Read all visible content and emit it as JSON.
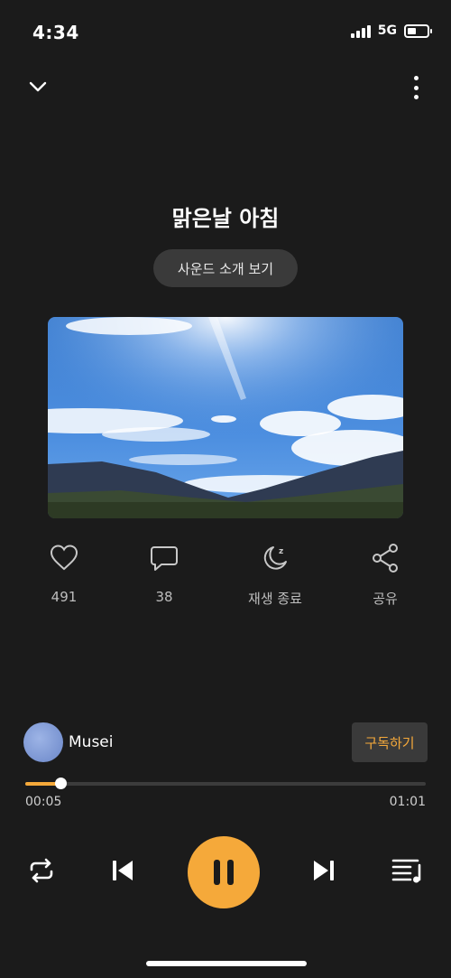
{
  "status_bar": {
    "time": "4:34",
    "network": "5G",
    "battery_level": 0.45
  },
  "header": {
    "collapse_icon": "chevron-down-icon",
    "menu_icon": "more-vertical-icon"
  },
  "track": {
    "title": "맑은날 아침",
    "intro_button_label": "사운드 소개 보기"
  },
  "actions": [
    {
      "icon": "heart-icon",
      "label": "491"
    },
    {
      "icon": "comment-icon",
      "label": "38"
    },
    {
      "icon": "sleep-timer-icon",
      "label": "재생 종료"
    },
    {
      "icon": "share-icon",
      "label": "공유"
    }
  ],
  "artist": {
    "name": "Musei",
    "subscribe_label": "구독하기"
  },
  "playback": {
    "current_time": "00:05",
    "total_time": "01:01",
    "progress": 0.087
  },
  "controls": {
    "repeat_icon": "repeat-icon",
    "previous_icon": "skip-previous-icon",
    "pause_icon": "pause-icon",
    "next_icon": "skip-next-icon",
    "playlist_icon": "playlist-icon"
  },
  "colors": {
    "accent": "#f5a93a",
    "background": "#1b1b1b"
  }
}
